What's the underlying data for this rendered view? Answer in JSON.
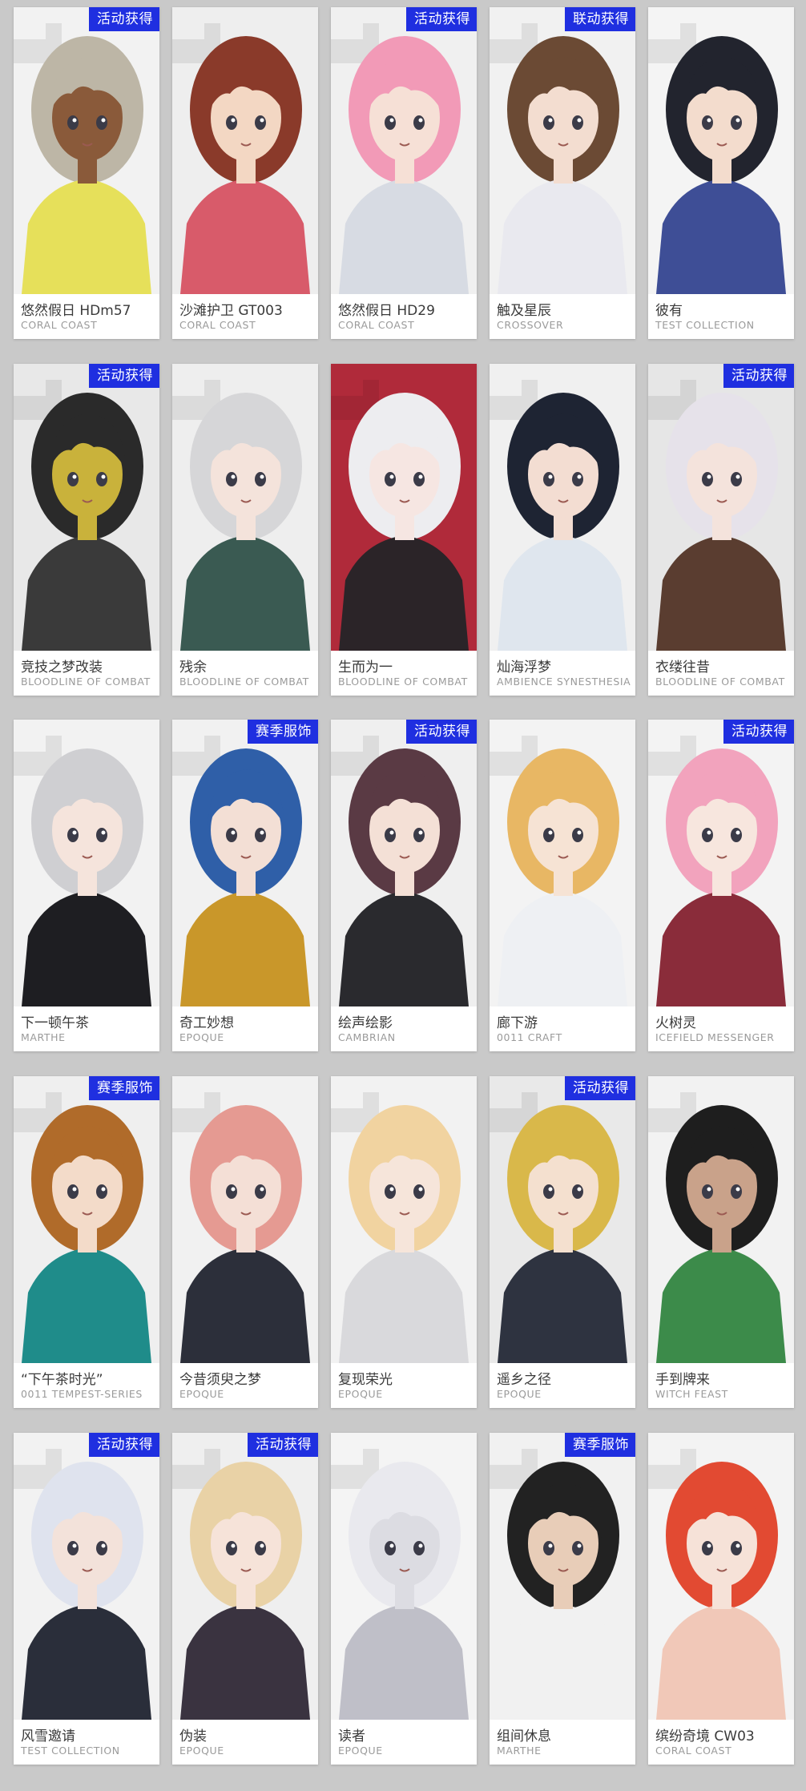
{
  "badges": {
    "event": "活动获得",
    "collab": "联动获得",
    "season": "赛季服饰"
  },
  "outfits": [
    {
      "name": "悠然假日 HDm57",
      "series": "CORAL COAST",
      "badge": "活动获得",
      "hair": "#bdb6a6",
      "skin": "#8a5a3a",
      "outfit": "#e6e05a",
      "bg": "#f2f2f2"
    },
    {
      "name": "沙滩护卫 GT003",
      "series": "CORAL COAST",
      "badge": "",
      "hair": "#8a3a2a",
      "skin": "#f3d7c3",
      "outfit": "#d85b6a",
      "bg": "#eeeeee"
    },
    {
      "name": "悠然假日 HD29",
      "series": "CORAL COAST",
      "badge": "活动获得",
      "hair": "#f29ab7",
      "skin": "#f6e0d6",
      "outfit": "#d7dbe3",
      "bg": "#f0f0f0"
    },
    {
      "name": "触及星辰",
      "series": "CROSSOVER",
      "badge": "联动获得",
      "hair": "#6b4a34",
      "skin": "#f3ddd0",
      "outfit": "#e9e9ef",
      "bg": "#f1f1f1"
    },
    {
      "name": "彼有",
      "series": "TEST COLLECTION",
      "badge": "",
      "hair": "#22242e",
      "skin": "#f3dccd",
      "outfit": "#3e4e96",
      "bg": "#f4f4f4"
    },
    {
      "name": "竞技之梦改装",
      "series": "BLOODLINE OF COMBAT",
      "badge": "活动获得",
      "hair": "#2a2a2a",
      "skin": "#c9b23b",
      "outfit": "#3a3a3a",
      "bg": "#e8e8e8"
    },
    {
      "name": "残余",
      "series": "BLOODLINE OF COMBAT",
      "badge": "",
      "hair": "#d6d6d8",
      "skin": "#f4e3db",
      "outfit": "#3a5a52",
      "bg": "#eeeeee"
    },
    {
      "name": "生而为一",
      "series": "BLOODLINE OF COMBAT",
      "badge": "",
      "hair": "#ededf0",
      "skin": "#f6e6e2",
      "outfit": "#2b2428",
      "bg": "#b02a3a"
    },
    {
      "name": "灿海浮梦",
      "series": "AMBIENCE SYNESTHESIA",
      "badge": "",
      "hair": "#1e2433",
      "skin": "#f3ddd2",
      "outfit": "#dfe6ee",
      "bg": "#f0f0f0"
    },
    {
      "name": "衣缕往昔",
      "series": "BLOODLINE OF COMBAT",
      "badge": "活动获得",
      "hair": "#e6e2ea",
      "skin": "#f4e3dc",
      "outfit": "#5a3d30",
      "bg": "#e6e6e6"
    },
    {
      "name": "下一顿午茶",
      "series": "MARTHE",
      "badge": "",
      "hair": "#cfcfd2",
      "skin": "#f5e4dc",
      "outfit": "#1e1e22",
      "bg": "#f2f2f2"
    },
    {
      "name": "奇工妙想",
      "series": "EPOQUE",
      "badge": "赛季服饰",
      "hair": "#2f5fa8",
      "skin": "#f3dfd5",
      "outfit": "#c9972a",
      "bg": "#f1f1f1"
    },
    {
      "name": "绘声绘影",
      "series": "CAMBRIAN",
      "badge": "活动获得",
      "hair": "#5a3a44",
      "skin": "#f4e0d6",
      "outfit": "#2a2a2e",
      "bg": "#efefef"
    },
    {
      "name": "廊下游",
      "series": "0011 CRAFT",
      "badge": "",
      "hair": "#e8b764",
      "skin": "#f6e3d4",
      "outfit": "#eef0f3",
      "bg": "#f3f3f3"
    },
    {
      "name": "火树灵",
      "series": "ICEFIELD MESSENGER",
      "badge": "活动获得",
      "hair": "#f2a3bd",
      "skin": "#f7e6de",
      "outfit": "#8a2c3a",
      "bg": "#f3f3f3"
    },
    {
      "name": "“下午茶时光”",
      "series": "0011 TEMPEST-SERIES",
      "badge": "赛季服饰",
      "hair": "#b06b2a",
      "skin": "#f3dbc9",
      "outfit": "#1f8c8a",
      "bg": "#efefef"
    },
    {
      "name": "今昔须臾之梦",
      "series": "EPOQUE",
      "badge": "",
      "hair": "#e59a92",
      "skin": "#f4dfd6",
      "outfit": "#2c2f3a",
      "bg": "#f1f1f1"
    },
    {
      "name": "复现荣光",
      "series": "EPOQUE",
      "badge": "",
      "hair": "#f1d3a0",
      "skin": "#f6e5da",
      "outfit": "#d9d9dc",
      "bg": "#f2f2f2"
    },
    {
      "name": "遥乡之径",
      "series": "EPOQUE",
      "badge": "活动获得",
      "hair": "#d9b84a",
      "skin": "#f4e0cf",
      "outfit": "#2e3340",
      "bg": "#e9e9e9"
    },
    {
      "name": "手到牌来",
      "series": "WITCH FEAST",
      "badge": "",
      "hair": "#1e1e1e",
      "skin": "#c9a28a",
      "outfit": "#3c8b4a",
      "bg": "#f2f2f2"
    },
    {
      "name": "风雪邀请",
      "series": "TEST COLLECTION",
      "badge": "活动获得",
      "hair": "#dfe3ee",
      "skin": "#f3e2da",
      "outfit": "#2a2e3a",
      "bg": "#f2f2f2"
    },
    {
      "name": "伪装",
      "series": "EPOQUE",
      "badge": "活动获得",
      "hair": "#e9d2a6",
      "skin": "#f6e3d9",
      "outfit": "#3a3340",
      "bg": "#efefef"
    },
    {
      "name": "读者",
      "series": "EPOQUE",
      "badge": "",
      "hair": "#e9e9ee",
      "skin": "#dcdce2",
      "outfit": "#bfbfc8",
      "bg": "#f4f4f4"
    },
    {
      "name": "组间休息",
      "series": "MARTHE",
      "badge": "赛季服饰",
      "hair": "#222222",
      "skin": "#e8cdb8",
      "outfit": "#f1f1f1",
      "bg": "#f1f1f1"
    },
    {
      "name": "缤纷奇境 CW03",
      "series": "CORAL COAST",
      "badge": "",
      "hair": "#e24a32",
      "skin": "#f6e2d8",
      "outfit": "#f1c8b8",
      "bg": "#f3f3f3"
    }
  ]
}
